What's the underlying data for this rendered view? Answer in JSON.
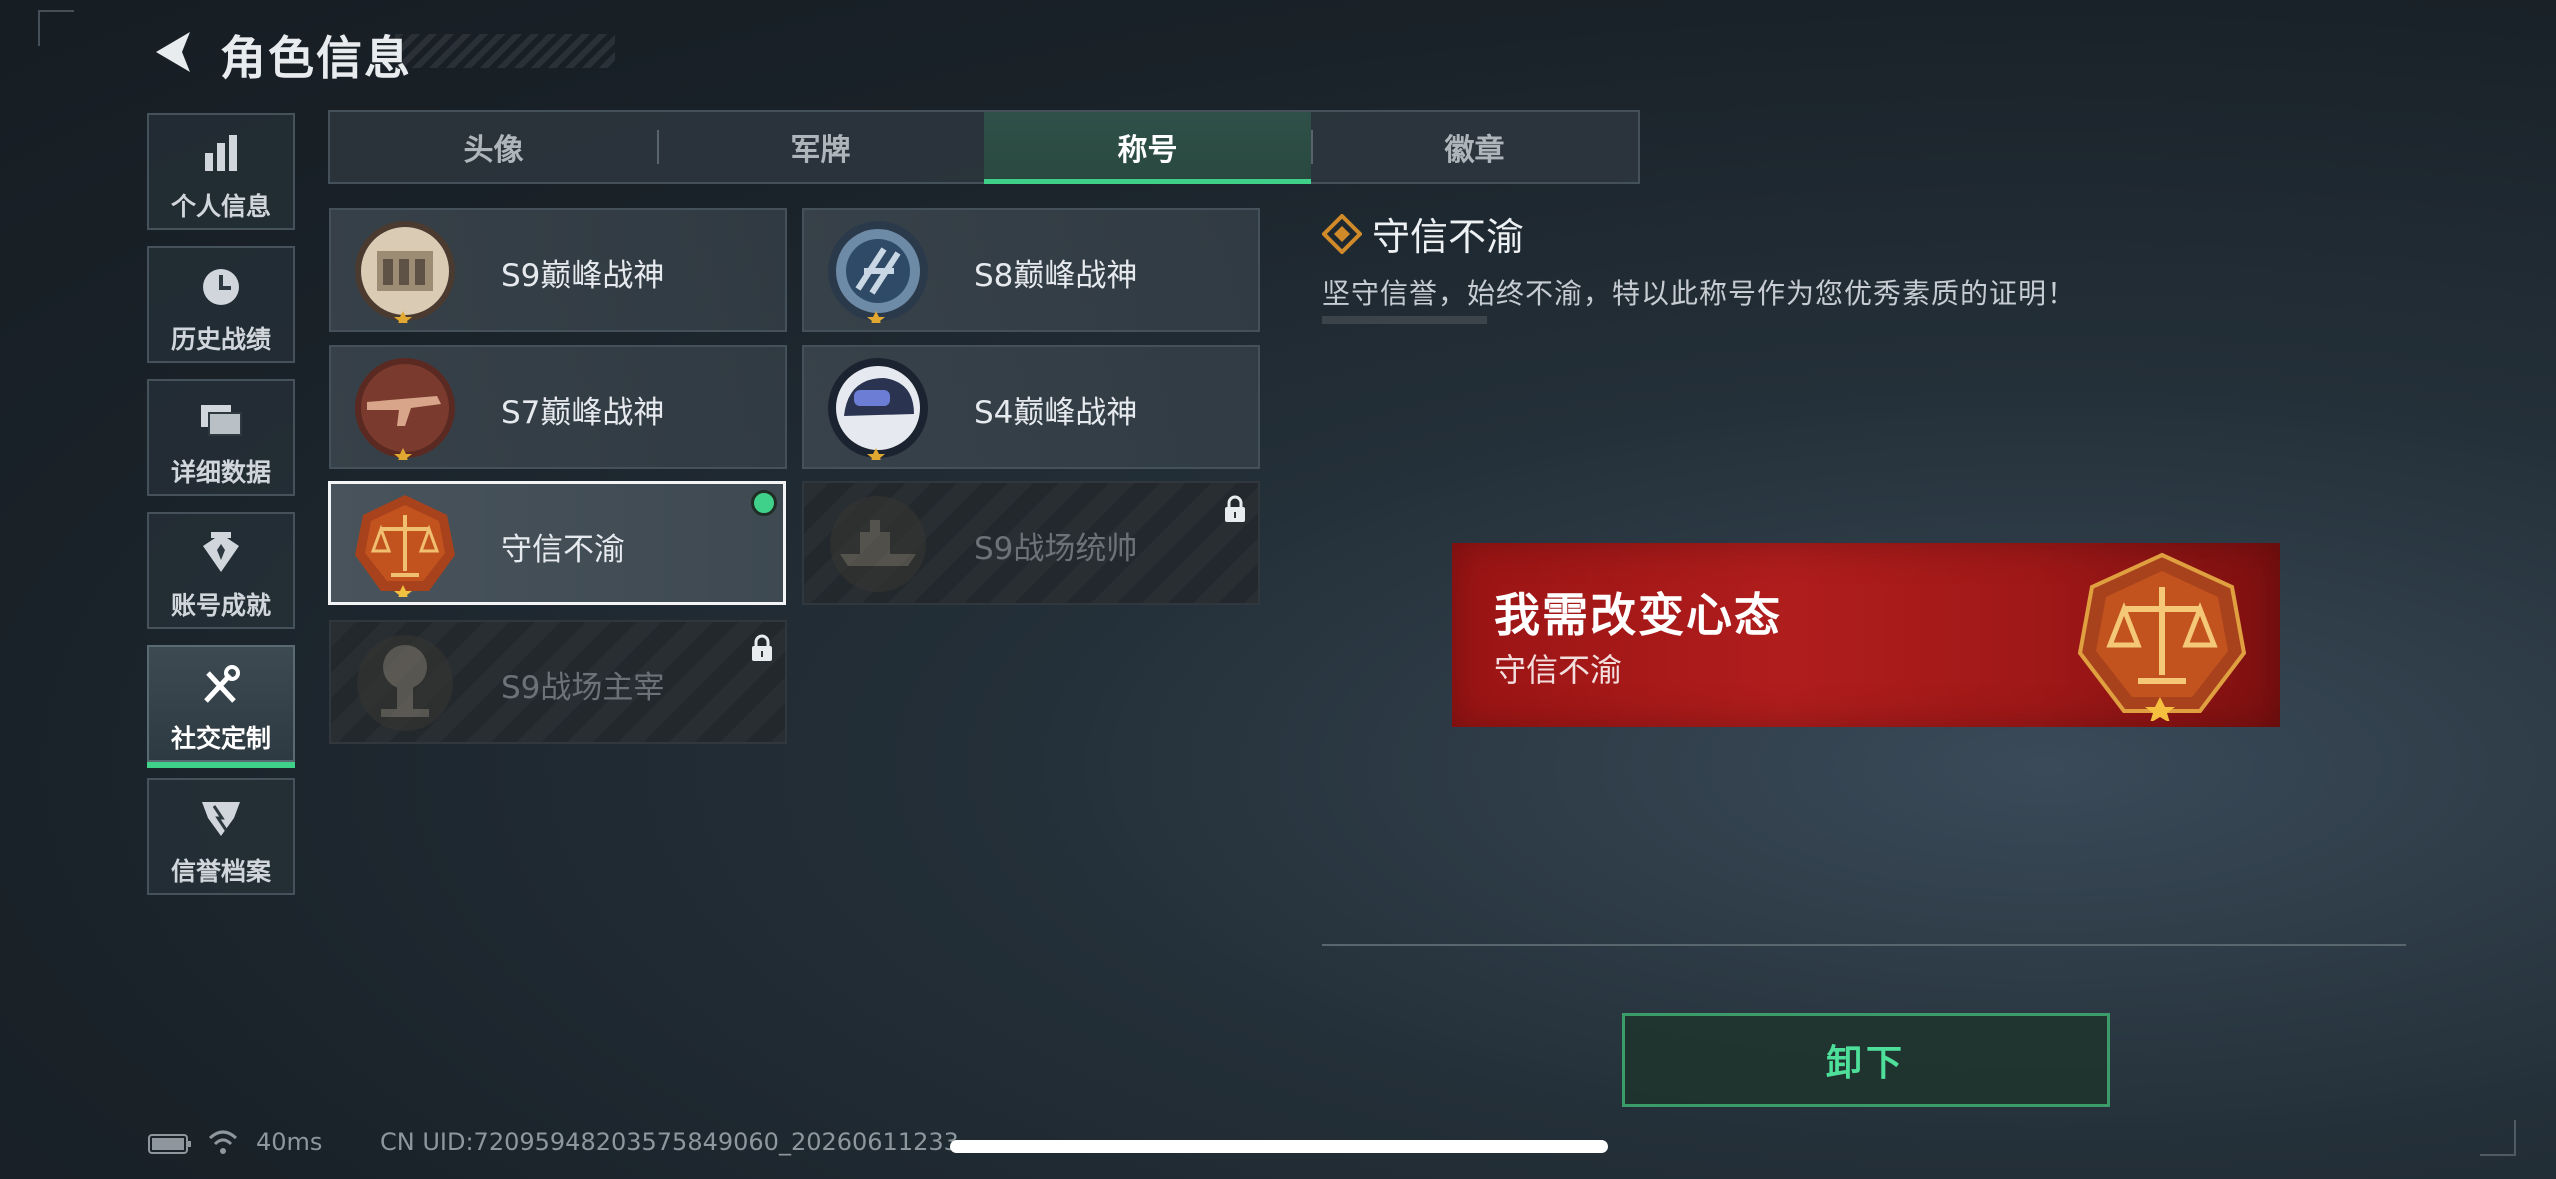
{
  "header": {
    "title": "角色信息"
  },
  "sidebar": {
    "items": [
      {
        "label": "个人信息",
        "icon": "bar-chart-icon"
      },
      {
        "label": "历史战绩",
        "icon": "clock-icon"
      },
      {
        "label": "详细数据",
        "icon": "folder-icon"
      },
      {
        "label": "账号成就",
        "icon": "achievement-icon"
      },
      {
        "label": "社交定制",
        "icon": "tools-icon",
        "active": true
      },
      {
        "label": "信誉档案",
        "icon": "credit-shield-icon"
      }
    ]
  },
  "tabs": [
    {
      "label": "头像"
    },
    {
      "label": "军牌"
    },
    {
      "label": "称号",
      "active": true
    },
    {
      "label": "徽章"
    }
  ],
  "titles": [
    {
      "name": "S9巅峰战神",
      "icon": "fortress-badge-icon",
      "state": "owned"
    },
    {
      "name": "S8巅峰战神",
      "icon": "blue-globe-badge-icon",
      "state": "owned"
    },
    {
      "name": "S7巅峰战神",
      "icon": "rifle-badge-icon",
      "state": "owned"
    },
    {
      "name": "S4巅峰战神",
      "icon": "helmet-badge-icon",
      "state": "owned"
    },
    {
      "name": "守信不渝",
      "icon": "scales-badge-icon",
      "state": "equipped"
    },
    {
      "name": "S9战场统帅",
      "icon": "warship-badge-icon",
      "state": "locked"
    },
    {
      "name": "S9战场主宰",
      "icon": "mushroom-cloud-badge-icon",
      "state": "locked"
    }
  ],
  "detail": {
    "title": "守信不渝",
    "description": "坚守信誉，始终不渝，特以此称号作为您优秀素质的证明！",
    "preview_main": "我需改变心态",
    "preview_sub": "守信不渝",
    "action_label": "卸下"
  },
  "status": {
    "ping": "40ms",
    "uid": "CN UID:72095948203575849060_20260611233"
  },
  "colors": {
    "accent_green": "#3fd08a",
    "preview_red": "#a51a1a",
    "gold": "#d08a2a"
  }
}
